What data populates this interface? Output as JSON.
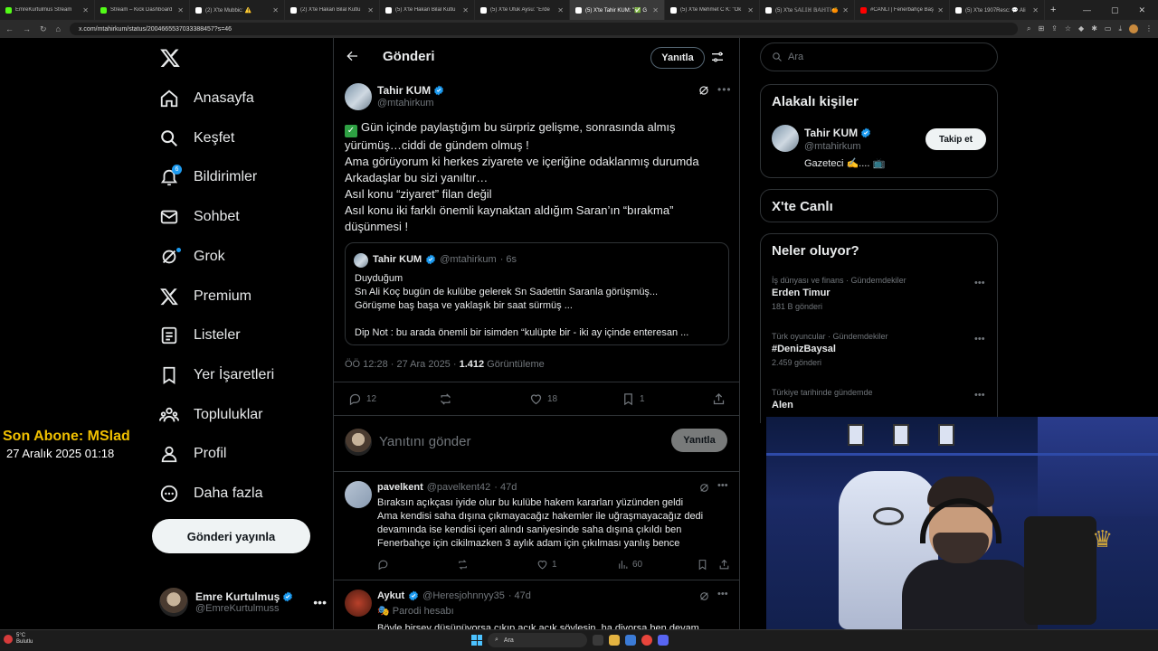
{
  "browser": {
    "tabs": [
      {
        "title": "EmreKurtulmus Stream",
        "type": "kick"
      },
      {
        "title": "Stream – Kick Dashboard",
        "type": "kick"
      },
      {
        "title": "(2) X'te Mubbic: ⚠️",
        "type": "x"
      },
      {
        "title": "(2) X'te Hakan Bilal Kutlu",
        "type": "x"
      },
      {
        "title": "(5) X'te Hakan Bilal Kutlu",
        "type": "x"
      },
      {
        "title": "(5) X'te Ufuk Aysu: \"Erde",
        "type": "x"
      },
      {
        "title": "(5) X'te Tahir KUM: \"✅ G",
        "type": "x",
        "active": true
      },
      {
        "title": "(5) X'te Mehmet C K: \"Ok",
        "type": "x"
      },
      {
        "title": "(5) X'te 𝕊𝔸𝕃𝕀ℍ 𝔹𝔸ℍ𝕋İ🍊",
        "type": "x"
      },
      {
        "title": "#CANLI | Fenerbahçe Baş",
        "type": "yt"
      },
      {
        "title": "(5) X'te 1907Resc: 💬 Ali",
        "type": "x"
      }
    ],
    "new_tab": "+",
    "url": "x.com/mtahirkum/status/2004665537033388457?s=46"
  },
  "nav": {
    "items": [
      {
        "label": "Anasayfa",
        "icon": "home-icon"
      },
      {
        "label": "Keşfet",
        "icon": "search-icon"
      },
      {
        "label": "Bildirimler",
        "icon": "bell-icon",
        "badge": "6"
      },
      {
        "label": "Sohbet",
        "icon": "mail-icon"
      },
      {
        "label": "Grok",
        "icon": "grok-icon"
      },
      {
        "label": "Premium",
        "icon": "x-icon"
      },
      {
        "label": "Listeler",
        "icon": "list-icon"
      },
      {
        "label": "Yer İşaretleri",
        "icon": "bookmark-icon"
      },
      {
        "label": "Topluluklar",
        "icon": "communities-icon"
      },
      {
        "label": "Profil",
        "icon": "profile-icon"
      },
      {
        "label": "Daha fazla",
        "icon": "more-circle-icon"
      }
    ],
    "post_button": "Gönderi yayınla",
    "account": {
      "name": "Emre Kurtulmuş",
      "handle": "@EmreKurtulmuss"
    }
  },
  "overlay": {
    "line1": "Son Abone: MSlad",
    "line2": "27 Aralık 2025   01:18"
  },
  "main": {
    "title": "Gönderi",
    "reply_pill": "Yanıtla",
    "tweet": {
      "author": "Tahir KUM",
      "handle": "@mtahirkum",
      "lines": [
        "Gün içinde paylaştığım bu sürpriz gelişme, sonrasında almış",
        "yürümüş…ciddi de gündem olmuş !",
        "Ama görüyorum ki herkes ziyarete ve içeriğine odaklanmış durumda",
        "Arkadaşlar bu sizi yanıltır…",
        "Asıl konu “ziyaret” filan değil",
        "Asıl konu iki farklı önemli kaynaktan aldığım Saran’ın “bırakma”",
        "düşünmesi !"
      ],
      "quote": {
        "author": "Tahir KUM",
        "handle": "@mtahirkum",
        "time": "· 6s",
        "lines": [
          "Duyduğum",
          "Sn Ali Koç bugün de kulübe gelerek Sn Sadettin Saranla görüşmüş...",
          "Görüşme baş başa ve yaklaşık bir saat sürmüş ...",
          "",
          "Dip Not : bu arada önemli bir isimden “kulüpte bir - iki ay içinde enteresan ..."
        ]
      },
      "meta_time": "ÖÖ 12:28 · 27 Ara 2025 · ",
      "views": "1.412",
      "views_label": " Görüntüleme",
      "stats": {
        "replies": "12",
        "retweets": "",
        "likes": "18",
        "bookmarks": "1"
      }
    },
    "composer": {
      "placeholder": "Yanıtını gönder",
      "button": "Yanıtla"
    },
    "replies": [
      {
        "author": "pavelkent",
        "handle": "@pavelkent42",
        "time": "· 47d",
        "verified": false,
        "lines": [
          "Bıraksın açıkçası iyide olur bu kulübe hakem kararları yüzünden geldi",
          "Ama kendisi saha dışına çıkmayacağız hakemler ile uğraşmayacağız dedi",
          "devamında ise kendisi içeri alındı saniyesinde saha dışına çıkıldı ben",
          "Fenerbahçe için cikilmazken 3 aylık adam için çıkılması yanlış bence"
        ],
        "stats": {
          "replies": "",
          "retweets": "",
          "likes": "1",
          "views": "60"
        }
      },
      {
        "author": "Aykut",
        "handle": "@Heresjohnnyy35",
        "time": "· 47d",
        "verified": true,
        "badge_text": "Parodi hesabı",
        "lines": [
          "Böyle birsey düşünüyorsa çıkıp açık açık söylesin, ha diyorsa ben devam"
        ]
      }
    ]
  },
  "right": {
    "search_placeholder": "Ara",
    "relevant_title": "Alakalı kişiler",
    "person": {
      "name": "Tahir KUM",
      "handle": "@mtahirkum",
      "bio": "Gazeteci ✍️.... 📺",
      "follow": "Takip et"
    },
    "live_title": "X'te Canlı",
    "trends_title": "Neler oluyor?",
    "trends": [
      {
        "category": "İş dünyası ve finans · Gündemdekiler",
        "name": "Erden Timur",
        "count": "181 B gönderi"
      },
      {
        "category": "Türk oyuncular · Gündemdekiler",
        "name": "#DenizBaysal",
        "count": "2.459 gönderi"
      },
      {
        "category": "Türkiye tarihinde gündemde",
        "name": "Alen",
        "count": ""
      }
    ]
  },
  "taskbar": {
    "weather_temp": "5°C",
    "weather_desc": "Bulutlu",
    "search": "Ara"
  },
  "colors": {
    "accent": "#1d9bf0",
    "overlay_gold": "#f0c000",
    "background": "#000000"
  }
}
